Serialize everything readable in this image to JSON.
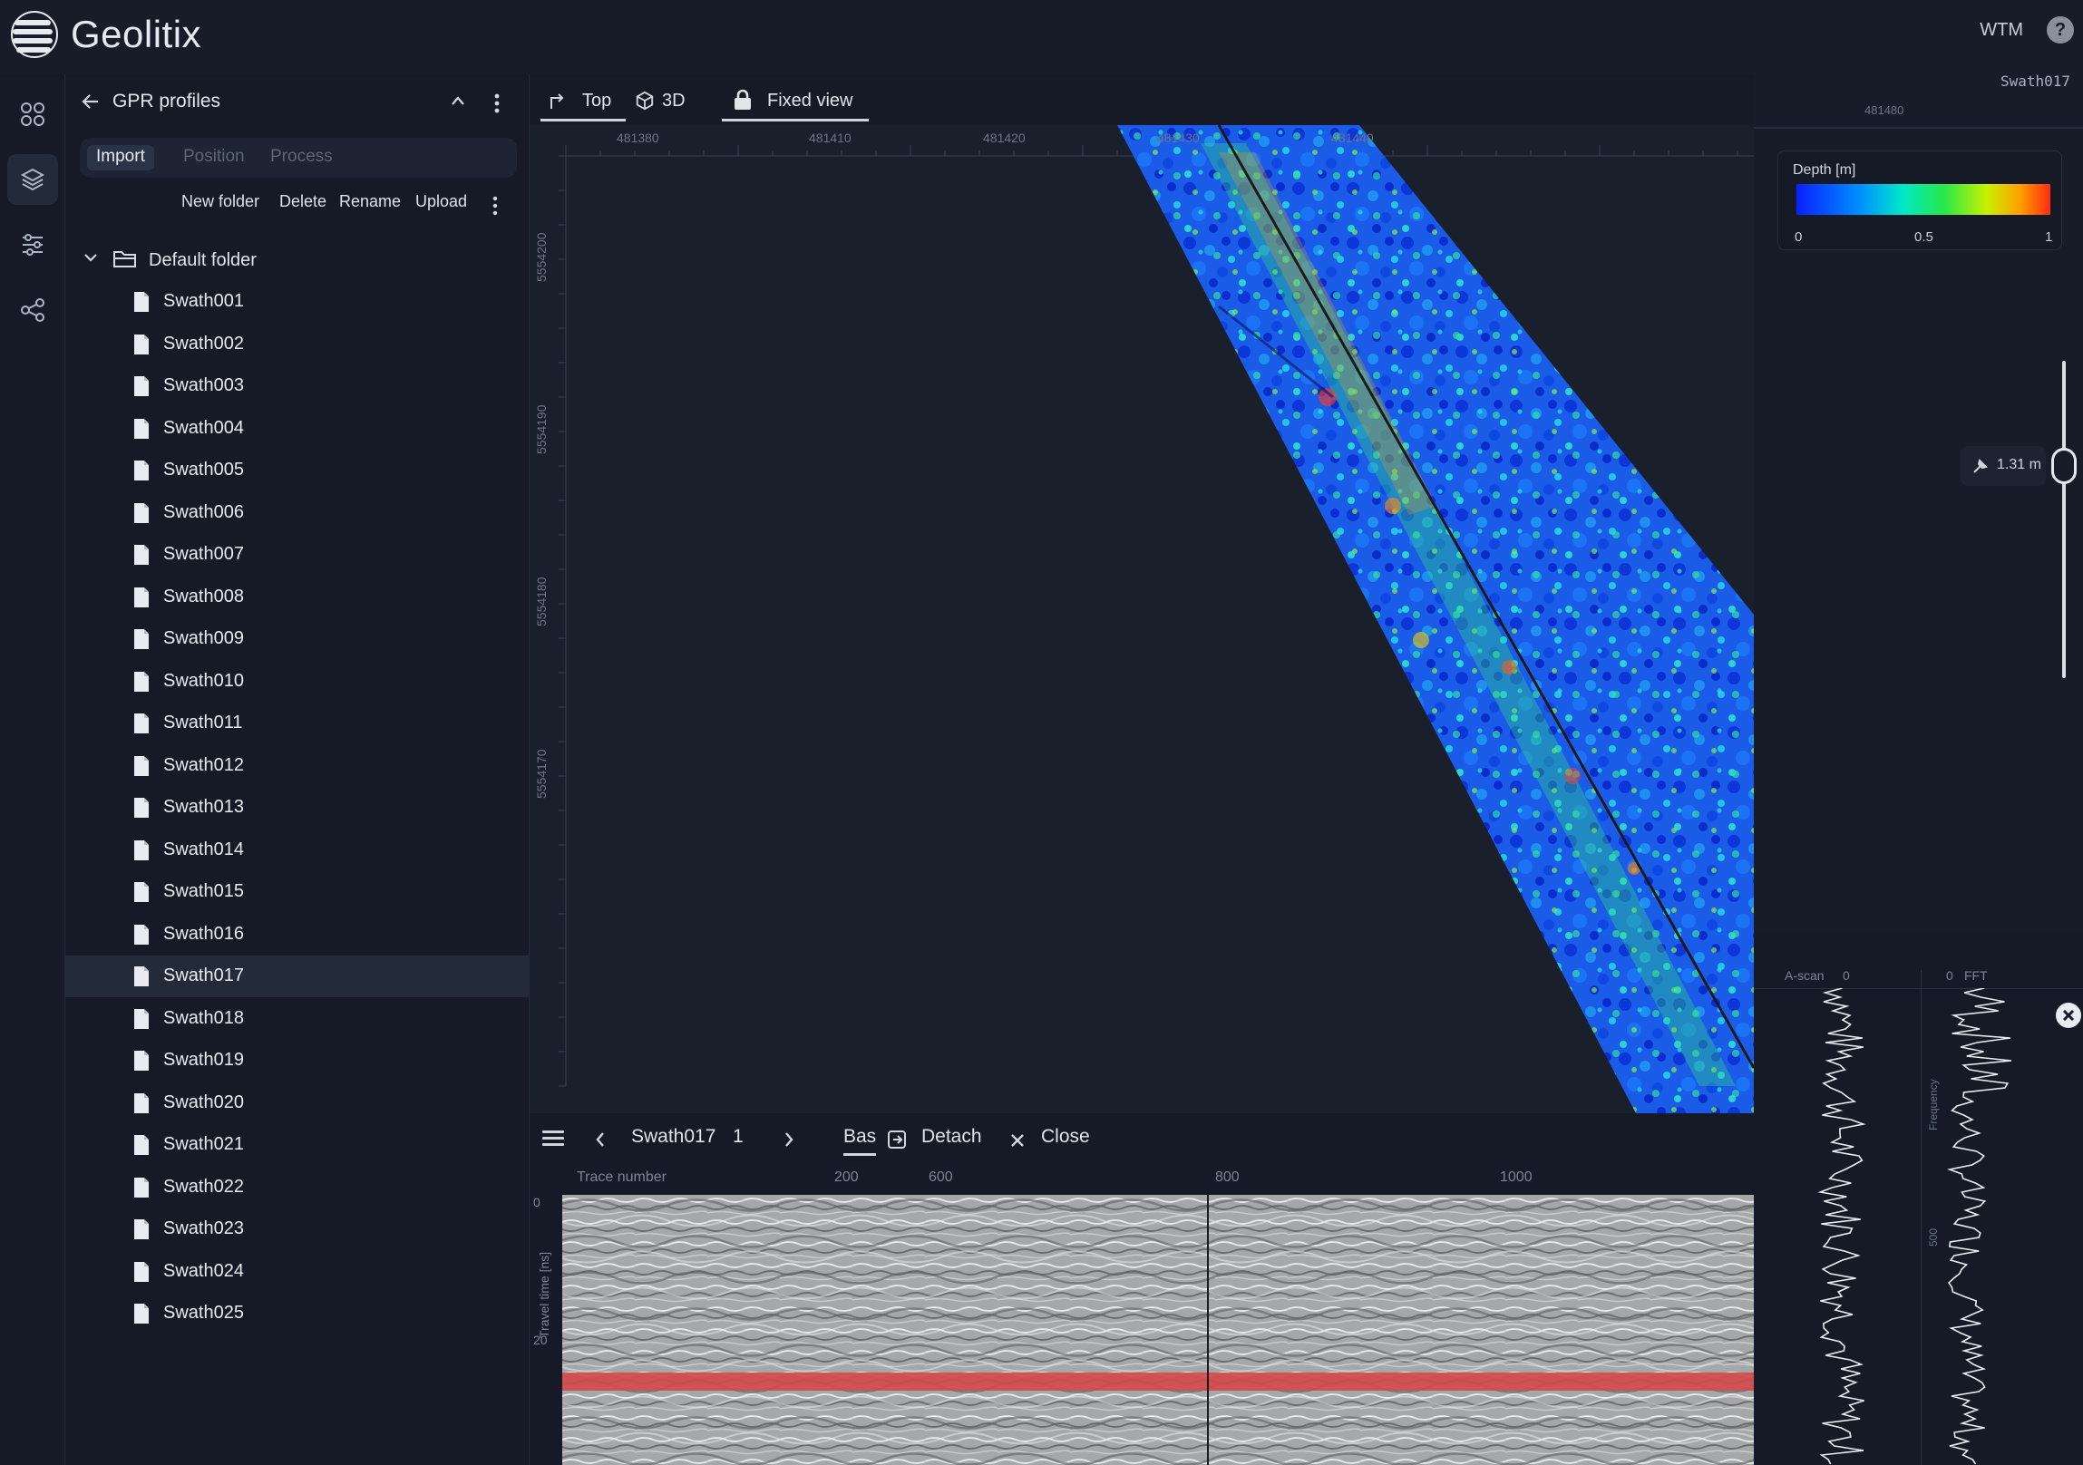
{
  "app": {
    "title": "Geolitix",
    "user_initials": "WTM",
    "help_label": "?"
  },
  "rail": [
    "apps-icon",
    "layers-icon",
    "sliders-icon",
    "share-icon"
  ],
  "panel": {
    "title": "GPR profiles",
    "tabs": [
      {
        "label": "Import",
        "state": "active"
      },
      {
        "label": "Position",
        "state": "disabled"
      },
      {
        "label": "Process",
        "state": "disabled"
      }
    ],
    "actions": [
      "New folder",
      "Delete",
      "Rename",
      "Upload"
    ],
    "folder": "Default folder",
    "files": [
      "Swath001",
      "Swath002",
      "Swath003",
      "Swath004",
      "Swath005",
      "Swath006",
      "Swath007",
      "Swath008",
      "Swath009",
      "Swath010",
      "Swath011",
      "Swath012",
      "Swath013",
      "Swath014",
      "Swath015",
      "Swath016",
      "Swath017",
      "Swath018",
      "Swath019",
      "Swath020",
      "Swath021",
      "Swath022",
      "Swath023",
      "Swath024",
      "Swath025"
    ],
    "selected_file": "Swath017"
  },
  "map_toolbar": {
    "top": "Top",
    "three_d": "3D",
    "fixed_view": "Fixed view"
  },
  "map": {
    "x_ticks": [
      "481380",
      "481410",
      "481420",
      "481430",
      "481440"
    ],
    "y_ticks": [
      "5554200",
      "5554190",
      "5554180",
      "5554170"
    ]
  },
  "right_panel": {
    "title": "Swath017",
    "mini_axis_tick": "481480",
    "legend": {
      "title": "Depth [m]",
      "ticks": [
        "0",
        "0.5",
        "1"
      ]
    },
    "depth_value": "1.31 m"
  },
  "bottom": {
    "profile_name": "Swath017",
    "profile_index": "1",
    "bas": "Bas",
    "detach": "Detach",
    "close": "Close",
    "x_label": "Trace number",
    "x_ticks": [
      "200",
      "600",
      "800",
      "1000"
    ],
    "y_label": "Travel time [ns]",
    "y_ticks": [
      "0",
      "20"
    ]
  },
  "ascan": {
    "title": "A-scan",
    "zero": "0",
    "fft_zero": "0",
    "fft_title": "FFT",
    "fft_y_label": "Frequency",
    "fft_tick": "500"
  },
  "colors": {
    "accent": "#cfd5e0",
    "bg": "#151a26",
    "red_line": "#d24b4b"
  }
}
